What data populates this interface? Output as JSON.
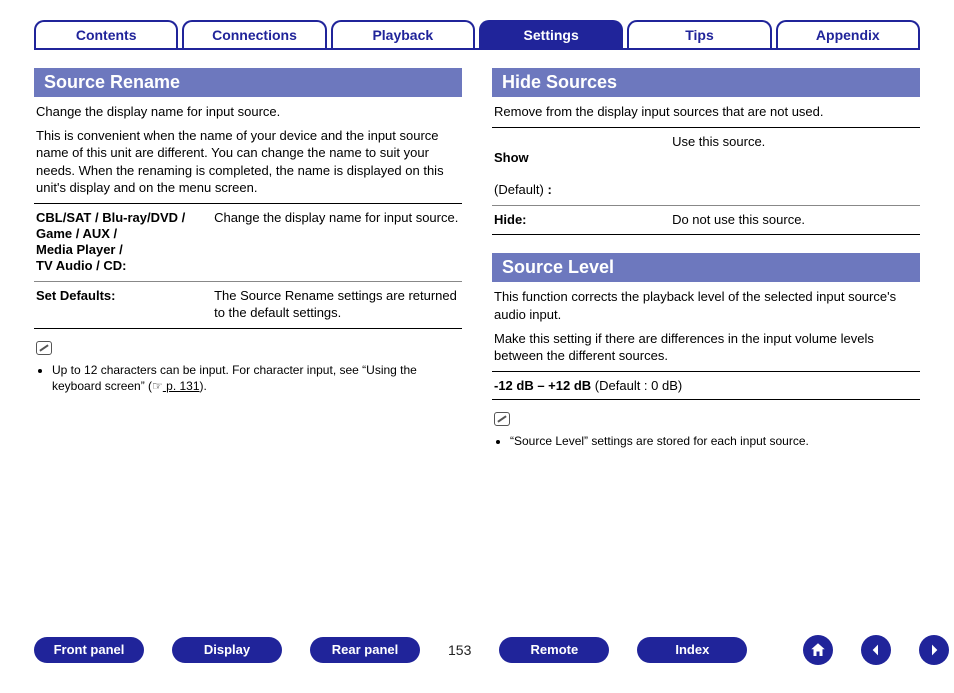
{
  "tabs": {
    "contents": "Contents",
    "connections": "Connections",
    "playback": "Playback",
    "settings": "Settings",
    "tips": "Tips",
    "appendix": "Appendix",
    "active": "settings"
  },
  "left": {
    "section_title": "Source Rename",
    "desc_line1": "Change the display name for input source.",
    "desc_para": "This is convenient when the name of your device and the input source name of this unit are different. You can change the name to suit your needs. When the renaming is completed, the name is displayed on this unit's display and on the menu screen.",
    "rows": [
      {
        "key": "CBL/SAT / Blu-ray/DVD /\nGame / AUX /\nMedia Player /\nTV Audio / CD:",
        "val": "Change the display name for input source."
      },
      {
        "key": "Set Defaults:",
        "val": "The Source Rename settings are returned to the default settings."
      }
    ],
    "note_pre": "Up to 12 characters can be input. For character input, see “Using the keyboard screen” (",
    "note_ref_icon": "☞",
    "note_ref": " p. 131",
    "note_post": ")."
  },
  "right_hide": {
    "section_title": "Hide Sources",
    "desc": "Remove from the display input sources that are not used.",
    "rows": [
      {
        "key": "Show",
        "paren": "(Default)",
        "colon": " :",
        "val": "Use this source."
      },
      {
        "key": "Hide:",
        "val": "Do not use this source."
      }
    ]
  },
  "right_level": {
    "section_title": "Source Level",
    "desc_line1": "This function corrects the playback level of the selected input source's audio input.",
    "desc_line2": "Make this setting if there are differences in the input volume levels between the different sources.",
    "range_bold": "-12 dB – +12 dB",
    "range_rest": " (Default : 0 dB)",
    "note": "“Source Level” settings are stored for each input source."
  },
  "bottom": {
    "front_panel": "Front panel",
    "display": "Display",
    "rear_panel": "Rear panel",
    "page": "153",
    "remote": "Remote",
    "index": "Index"
  }
}
